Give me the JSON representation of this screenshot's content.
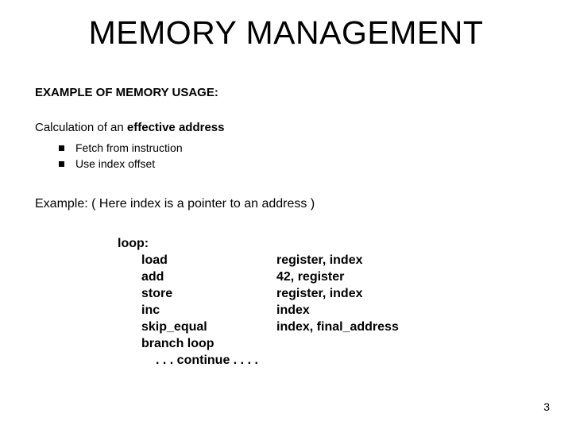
{
  "title": "MEMORY MANAGEMENT",
  "section_heading": "EXAMPLE OF MEMORY USAGE:",
  "subheading_plain": "Calculation of an ",
  "subheading_bold": "effective address",
  "bullets": [
    "Fetch from instruction",
    "Use index offset"
  ],
  "example_line": "Example: ( Here index is a pointer to an address )",
  "code": {
    "label": "loop:",
    "rows": [
      {
        "mnemonic": "load",
        "args": "register, index"
      },
      {
        "mnemonic": "add",
        "args": "42, register"
      },
      {
        "mnemonic": "store",
        "args": "register, index"
      },
      {
        "mnemonic": "inc",
        "args": "index"
      },
      {
        "mnemonic": "skip_equal",
        "args": "index, final_address"
      },
      {
        "mnemonic": "branch   loop",
        "args": ""
      }
    ],
    "continue": ". . . continue . . . ."
  },
  "page_number": "3"
}
